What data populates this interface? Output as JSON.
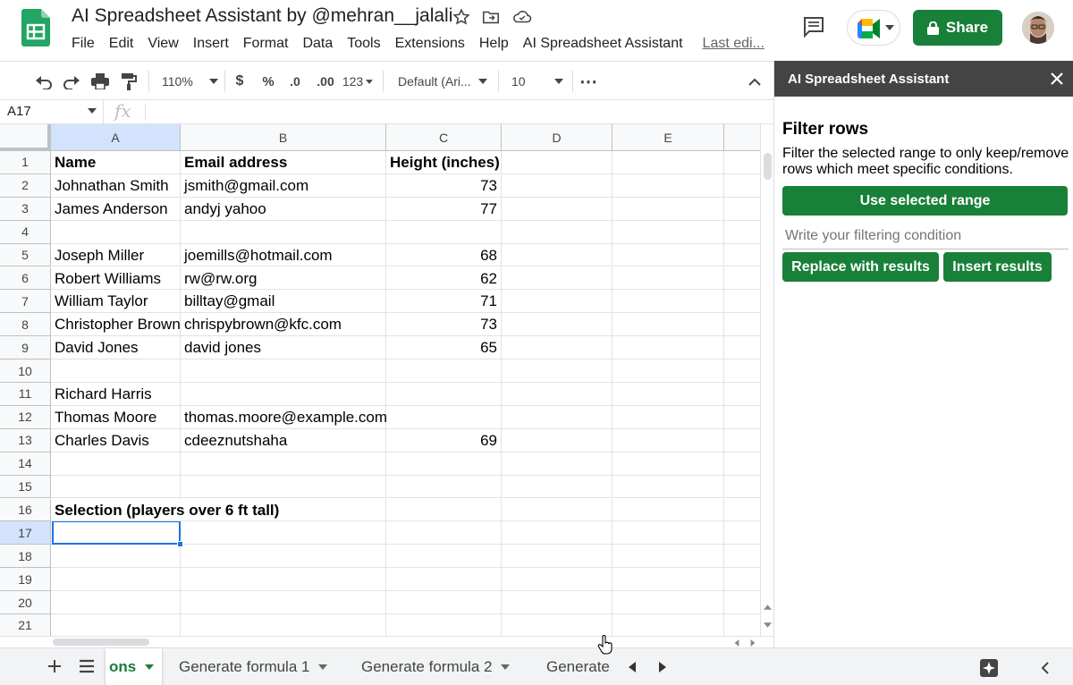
{
  "app": {
    "doc_title": "AI Spreadsheet Assistant by @mehran__jalali",
    "menu": [
      "File",
      "Edit",
      "View",
      "Insert",
      "Format",
      "Data",
      "Tools",
      "Extensions",
      "Help",
      "AI Spreadsheet Assistant"
    ],
    "last_edit": "Last edi...",
    "share_label": "Share"
  },
  "toolbar": {
    "zoom": "110%",
    "currency": "$",
    "percent": "%",
    "decrease_decimal": ".0",
    "increase_decimal": ".00",
    "more_formats": "123",
    "font": "Default (Ari...",
    "font_size": "10",
    "more": "⋯"
  },
  "formula_bar": {
    "name_box": "A17",
    "fx": "fx",
    "value": ""
  },
  "grid": {
    "columns": [
      "A",
      "B",
      "C",
      "D",
      "E"
    ],
    "selected_column": "A",
    "rows": [
      {
        "n": "1",
        "a": "Name",
        "b": "Email address",
        "c": "Height (inches)",
        "bold": true
      },
      {
        "n": "2",
        "a": "Johnathan Smith",
        "b": "jsmith@gmail.com",
        "c": "73"
      },
      {
        "n": "3",
        "a": "James Anderson",
        "b": "andyj yahoo",
        "c": "77"
      },
      {
        "n": "4",
        "a": "",
        "b": "",
        "c": ""
      },
      {
        "n": "5",
        "a": "Joseph Miller",
        "b": "joemills@hotmail.com",
        "c": "68"
      },
      {
        "n": "6",
        "a": "Robert Williams",
        "b": "rw@rw.org",
        "c": "62"
      },
      {
        "n": "7",
        "a": "William Taylor",
        "b": "billtay@gmail",
        "c": "71"
      },
      {
        "n": "8",
        "a": "Christopher Brown",
        "b": "chrispybrown@kfc.com",
        "c": "73"
      },
      {
        "n": "9",
        "a": "David Jones",
        "b": "david jones",
        "c": "65"
      },
      {
        "n": "10",
        "a": "",
        "b": "",
        "c": ""
      },
      {
        "n": "11",
        "a": "Richard Harris",
        "b": "",
        "c": ""
      },
      {
        "n": "12",
        "a": "Thomas Moore",
        "b": "thomas.moore@example.com",
        "c": ""
      },
      {
        "n": "13",
        "a": "Charles Davis",
        "b": "cdeeznutshaha",
        "c": "69"
      },
      {
        "n": "14",
        "a": "",
        "b": "",
        "c": ""
      },
      {
        "n": "15",
        "a": "",
        "b": "",
        "c": ""
      },
      {
        "n": "16",
        "a": "Selection (players over 6 ft tall)",
        "b": "",
        "c": "",
        "bold": true
      },
      {
        "n": "17",
        "a": "",
        "b": "",
        "c": ""
      },
      {
        "n": "18",
        "a": "",
        "b": "",
        "c": ""
      },
      {
        "n": "19",
        "a": "",
        "b": "",
        "c": ""
      },
      {
        "n": "20",
        "a": "",
        "b": "",
        "c": ""
      },
      {
        "n": "21",
        "a": "",
        "b": "",
        "c": ""
      }
    ],
    "active_cell": "A17"
  },
  "sheets": {
    "tabs": [
      {
        "label": "ons",
        "active": true
      },
      {
        "label": "Generate formula 1",
        "active": false
      },
      {
        "label": "Generate formula 2",
        "active": false
      },
      {
        "label": "Generate",
        "active": false
      }
    ]
  },
  "panel": {
    "title": "AI Spreadsheet Assistant",
    "heading": "Filter rows",
    "description": "Filter the selected range to only keep/remove rows which meet specific conditions.",
    "use_range_label": "Use selected range",
    "condition_placeholder": "Write your filtering condition",
    "replace_label": "Replace with results",
    "insert_label": "Insert results"
  },
  "colors": {
    "brand_green": "#188038",
    "selection_blue": "#1a73e8",
    "header_gray": "#f8f9fa",
    "panel_header": "#444444"
  }
}
